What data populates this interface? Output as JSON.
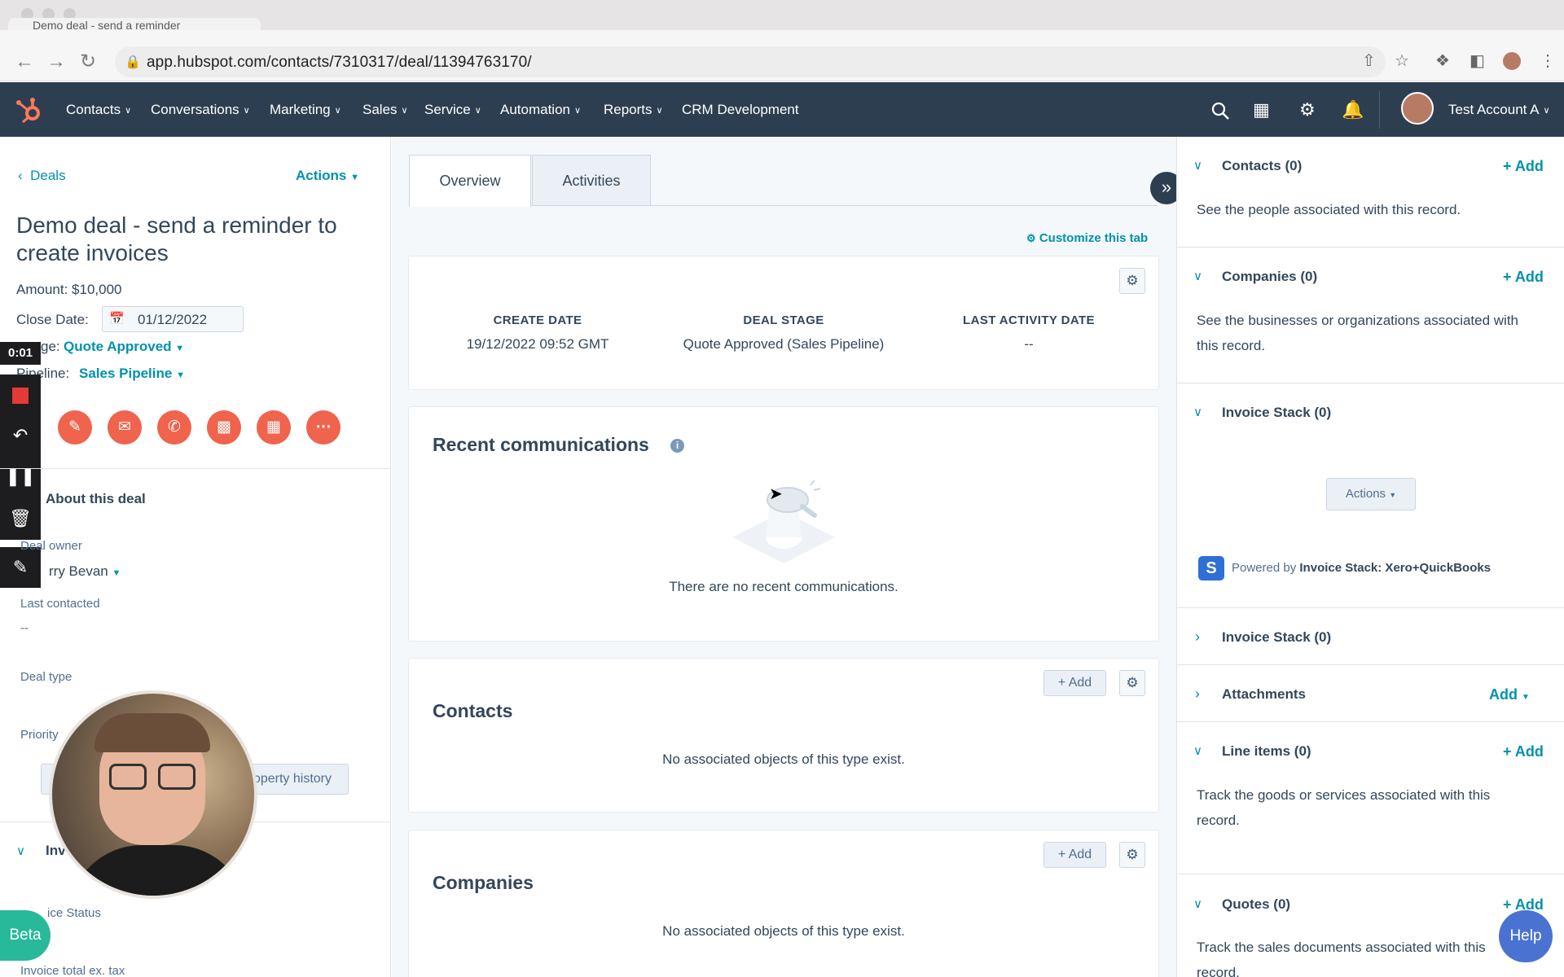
{
  "browser": {
    "tab_title": "Demo deal - send a reminder",
    "url": "app.hubspot.com/contacts/7310317/deal/11394763170/"
  },
  "nav": {
    "items": [
      "Contacts",
      "Conversations",
      "Marketing",
      "Sales",
      "Service",
      "Automation",
      "Reports"
    ],
    "crm_dev": "CRM Development",
    "account": "Test Account A"
  },
  "left": {
    "back": "Deals",
    "actions": "Actions",
    "title": "Demo deal - send a reminder to create invoices",
    "amount": "Amount: $10,000",
    "close_label": "Close Date:",
    "close_value": "01/12/2022",
    "stage_label": "ge:",
    "stage_value": "Quote Approved",
    "pipeline_label": "Pipeline:",
    "pipeline_value": "Sales Pipeline",
    "timer": "0:01",
    "about": "About this deal",
    "deal_owner_label": "Deal owner",
    "deal_owner_value": "rry Bevan",
    "last_contacted_label": "Last contacted",
    "last_contacted_value": "--",
    "deal_type_label": "Deal type",
    "priority_label": "Priority",
    "property_history": "operty history",
    "inv_section": "Inv",
    "invoice_status_label": "ice Status",
    "invoice_total_label": "Invoice total ex. tax",
    "beta": "Beta"
  },
  "middle": {
    "tabs": [
      "Overview",
      "Activities"
    ],
    "customize": "Customize this tab",
    "summary": [
      {
        "label": "CREATE DATE",
        "value": "19/12/2022 09:52 GMT"
      },
      {
        "label": "DEAL STAGE",
        "value": "Quote Approved (Sales Pipeline)"
      },
      {
        "label": "LAST ACTIVITY DATE",
        "value": "--"
      }
    ],
    "recent_title": "Recent communications",
    "recent_empty": "There are no recent communications.",
    "contacts_title": "Contacts",
    "contacts_empty": "No associated objects of this type exist.",
    "companies_title": "Companies",
    "companies_empty": "No associated objects of this type exist.",
    "add": "+ Add"
  },
  "right": {
    "contacts": {
      "title": "Contacts (0)",
      "add": "+ Add",
      "text": "See the people associated with this record."
    },
    "companies": {
      "title": "Companies (0)",
      "add": "+ Add",
      "text": "See the businesses or organizations associated with this record."
    },
    "invoice_stack_open": {
      "title": "Invoice Stack (0)",
      "actions": "Actions",
      "powered_prefix": "Powered by",
      "powered_name": "Invoice Stack: Xero+QuickBooks"
    },
    "invoice_stack_closed": {
      "title": "Invoice Stack (0)"
    },
    "attachments": {
      "title": "Attachments",
      "add": "Add"
    },
    "line_items": {
      "title": "Line items (0)",
      "add": "+ Add",
      "text": "Track the goods or services associated with this record."
    },
    "quotes": {
      "title": "Quotes (0)",
      "add": "+ Add",
      "text": "Track the sales documents associated with this record."
    },
    "help": "Help"
  },
  "colors": {
    "nav_bg": "#2d3e50",
    "accent": "#0091ae",
    "action_red": "#f0634d",
    "beta": "#28b99a",
    "help": "#4a73d1"
  }
}
